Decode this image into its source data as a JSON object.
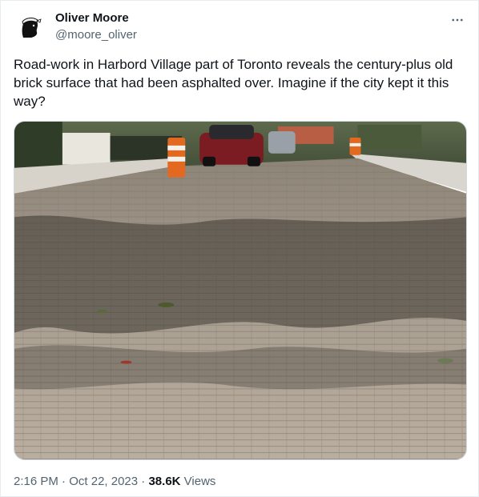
{
  "author": {
    "name": "Oliver Moore",
    "handle": "@moore_oliver"
  },
  "tweet": {
    "text": "Road-work in Harbord Village part of Toronto reveals the century-plus old brick surface that had been asphalted over. Imagine if the city kept it this way?"
  },
  "meta": {
    "time": "2:16 PM",
    "separator": " · ",
    "date": "Oct 22, 2023",
    "views_count": "38.6K",
    "views_label": " Views"
  },
  "icons": {
    "more": "more-horizontal-icon",
    "avatar": "moor-head-avatar"
  },
  "colors": {
    "text_primary": "#0f1419",
    "text_secondary": "#536471",
    "border": "#cfd9de"
  }
}
